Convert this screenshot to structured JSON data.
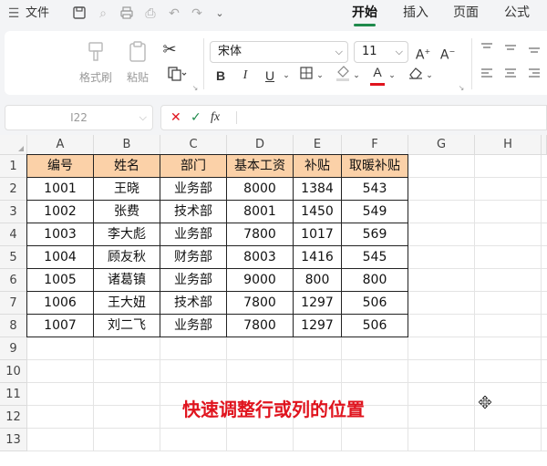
{
  "menubar": {
    "file_label": "文件",
    "tabs": [
      {
        "label": "开始",
        "active": true
      },
      {
        "label": "插入",
        "active": false
      },
      {
        "label": "页面",
        "active": false
      },
      {
        "label": "公式",
        "active": false
      }
    ]
  },
  "ribbon": {
    "format_painter_label": "格式刷",
    "paste_label": "粘贴",
    "font_name": "宋体",
    "font_size": "11",
    "bold": "B",
    "italic": "I",
    "underline": "U",
    "font_color_glyph": "A",
    "font_color": "#e0141e"
  },
  "formula_bar": {
    "name_box": "I22",
    "cancel_glyph": "✕",
    "confirm_glyph": "✓",
    "fx_label": "fx",
    "content": ""
  },
  "sheet": {
    "columns": [
      "A",
      "B",
      "C",
      "D",
      "E",
      "F",
      "G",
      "H"
    ],
    "rows": [
      "1",
      "2",
      "3",
      "4",
      "5",
      "6",
      "7",
      "8",
      "9",
      "10",
      "11",
      "12",
      "13"
    ],
    "table_headers": [
      "编号",
      "姓名",
      "部门",
      "基本工资",
      "补贴",
      "取暖补贴"
    ],
    "table_rows": [
      [
        "1001",
        "王晓",
        "业务部",
        "8000",
        "1384",
        "543"
      ],
      [
        "1002",
        "张费",
        "技术部",
        "8001",
        "1450",
        "549"
      ],
      [
        "1003",
        "李大彪",
        "业务部",
        "7800",
        "1017",
        "569"
      ],
      [
        "1004",
        "顾友秋",
        "财务部",
        "8003",
        "1416",
        "545"
      ],
      [
        "1005",
        "诸葛镇",
        "业务部",
        "9000",
        "800",
        "800"
      ],
      [
        "1006",
        "王大妞",
        "技术部",
        "7800",
        "1297",
        "506"
      ],
      [
        "1007",
        "刘二飞",
        "业务部",
        "7800",
        "1297",
        "506"
      ]
    ],
    "header_fill": "#fbd1a8"
  },
  "caption": "快速调整行或列的位置",
  "caption_color": "#e0141e"
}
